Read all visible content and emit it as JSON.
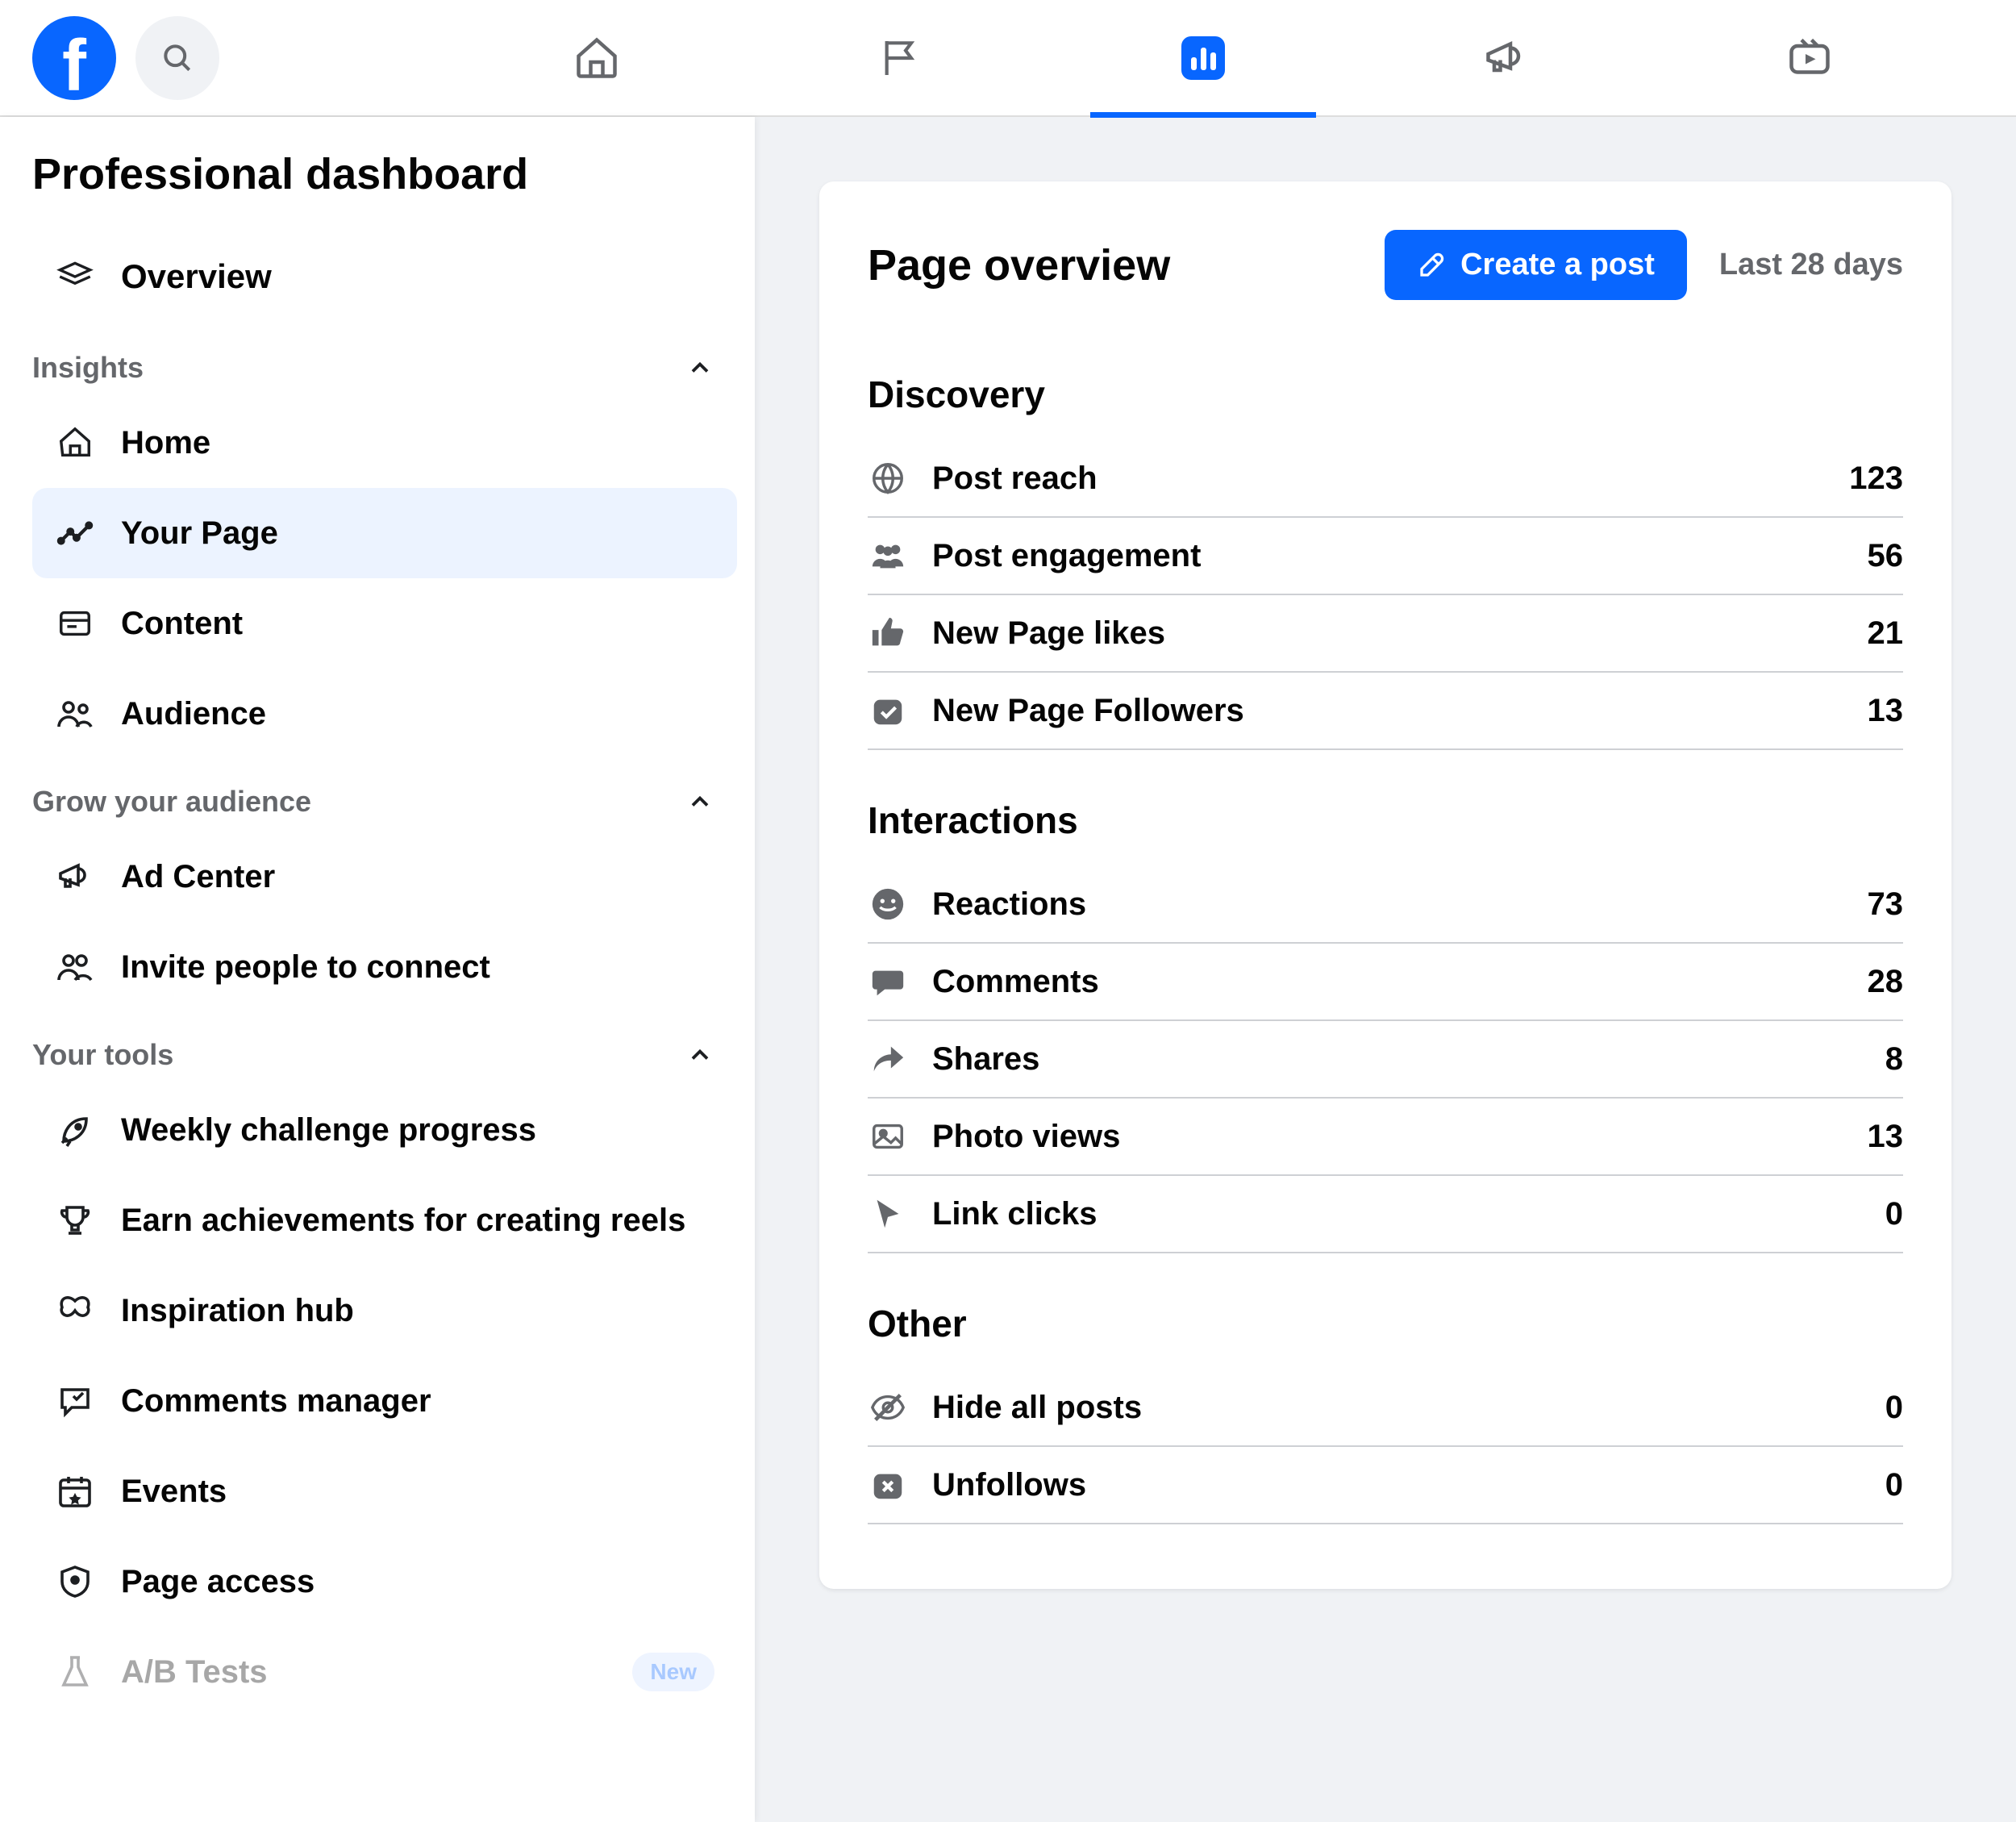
{
  "sidebar": {
    "title": "Professional dashboard",
    "overview": "Overview",
    "sections": {
      "insights": {
        "label": "Insights",
        "items": [
          "Home",
          "Your Page",
          "Content",
          "Audience"
        ],
        "active_index": 1
      },
      "grow": {
        "label": "Grow your audience",
        "items": [
          "Ad Center",
          "Invite people to connect"
        ]
      },
      "tools": {
        "label": "Your tools",
        "items": [
          "Weekly challenge progress",
          "Earn achievements for creating reels",
          "Inspiration hub",
          "Comments manager",
          "Events",
          "Page access",
          "A/B Tests"
        ],
        "new_badge": "New"
      }
    }
  },
  "overview": {
    "title": "Page overview",
    "create_post": "Create a post",
    "period": "Last 28 days",
    "sections": [
      {
        "title": "Discovery",
        "metrics": [
          {
            "icon": "globe",
            "label": "Post reach",
            "value": "123"
          },
          {
            "icon": "people",
            "label": "Post engagement",
            "value": "56"
          },
          {
            "icon": "thumb",
            "label": "New Page likes",
            "value": "21"
          },
          {
            "icon": "follow",
            "label": "New Page Followers",
            "value": "13"
          }
        ]
      },
      {
        "title": "Interactions",
        "metrics": [
          {
            "icon": "smile",
            "label": "Reactions",
            "value": "73"
          },
          {
            "icon": "comment",
            "label": "Comments",
            "value": "28"
          },
          {
            "icon": "share",
            "label": "Shares",
            "value": "8"
          },
          {
            "icon": "photo",
            "label": "Photo views",
            "value": "13"
          },
          {
            "icon": "cursor",
            "label": "Link clicks",
            "value": "0"
          }
        ]
      },
      {
        "title": "Other",
        "metrics": [
          {
            "icon": "eyeoff",
            "label": "Hide all posts",
            "value": "0"
          },
          {
            "icon": "unfollow",
            "label": "Unfollows",
            "value": "0"
          }
        ]
      }
    ]
  }
}
